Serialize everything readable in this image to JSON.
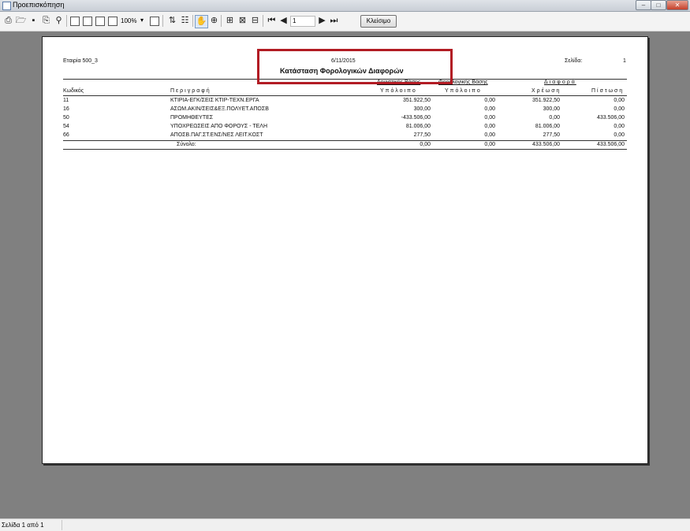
{
  "window": {
    "title": "Προεπισκόπηση"
  },
  "toolbar": {
    "zoom": "100%",
    "page_number": "1",
    "close_label": "Κλείσιμο"
  },
  "report": {
    "company": "Εταιρία 500_3",
    "date": "6/11/2015",
    "title": "Κατάσταση Φορολογικών Διαφορών",
    "page_label": "Σελίδα:",
    "page_value": "1",
    "group_headers": [
      "Λογιστικής Βάσης",
      "Φορολογικής Βάσης",
      "Διαφορά"
    ],
    "columns": [
      "Κωδικός",
      "Περιγραφή",
      "Υπόλοιπο",
      "Υπόλοιπο",
      "Χρέωση",
      "Πίστωση"
    ],
    "rows": [
      {
        "code": "11",
        "desc": "ΚΤΙΡΙΑ-ΕΓΚ/ΣΕΙΣ ΚΤΙΡ-ΤΕΧΝ.ΕΡΓΑ",
        "acc": "351.922,50",
        "tax": "0,00",
        "debit": "351.922,50",
        "credit": "0,00"
      },
      {
        "code": "16",
        "desc": "ΑΣΩΜ.ΑΚΙΝ/ΣΕΙΣ&ΕΞ.ΠΟΛΥΕΤ.ΑΠΟΣΒ",
        "acc": "300,00",
        "tax": "0,00",
        "debit": "300,00",
        "credit": "0,00"
      },
      {
        "code": "50",
        "desc": "ΠΡΟΜΗΘΕΥΤΕΣ",
        "acc": "-433.506,00",
        "tax": "0,00",
        "debit": "0,00",
        "credit": "433.506,00"
      },
      {
        "code": "54",
        "desc": "ΥΠΟΧΡΕΩΣΕΙΣ ΑΠΟ ΦΟΡΟΥΣ - ΤΕΛΗ",
        "acc": "81.006,00",
        "tax": "0,00",
        "debit": "81.006,00",
        "credit": "0,00"
      },
      {
        "code": "66",
        "desc": "ΑΠΟΣΒ.ΠΑΓ.ΣΤ.ΕΝΣ/ΝΕΣ ΛΕΙΤ.ΚΟΣΤ",
        "acc": "277,50",
        "tax": "0,00",
        "debit": "277,50",
        "credit": "0,00"
      }
    ],
    "total": {
      "label": "Σύνολο:",
      "acc": "0,00",
      "tax": "0,00",
      "debit": "433.506,00",
      "credit": "433.506,00"
    }
  },
  "status": {
    "text": "Σελίδα 1 από 1"
  },
  "colors": {
    "highlight": "#b21c24",
    "viewer_bg": "#808080"
  }
}
